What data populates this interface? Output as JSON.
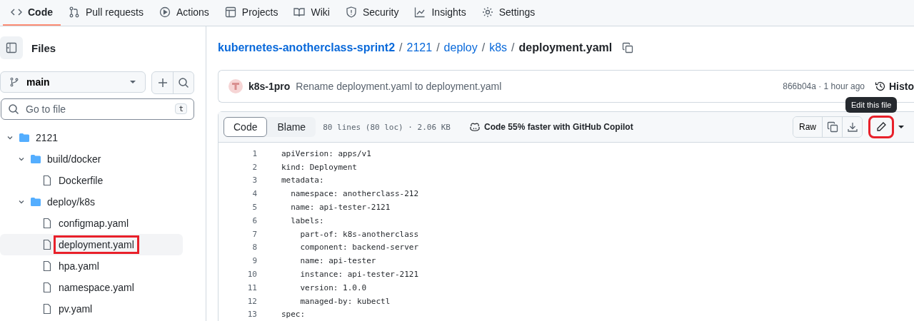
{
  "nav_tabs": [
    {
      "label": "Code",
      "selected": true
    },
    {
      "label": "Pull requests",
      "selected": false
    },
    {
      "label": "Actions",
      "selected": false
    },
    {
      "label": "Projects",
      "selected": false
    },
    {
      "label": "Wiki",
      "selected": false
    },
    {
      "label": "Security",
      "selected": false
    },
    {
      "label": "Insights",
      "selected": false
    },
    {
      "label": "Settings",
      "selected": false
    }
  ],
  "sidebar": {
    "title": "Files",
    "branch": "main",
    "search_placeholder": "Go to file",
    "search_key": "t",
    "tree": [
      {
        "name": "2121",
        "kind": "folder",
        "expanded": true,
        "selected": false,
        "highlighted": false,
        "children": [
          {
            "name": "build/docker",
            "kind": "folder",
            "expanded": true,
            "selected": false,
            "highlighted": false,
            "children": [
              {
                "name": "Dockerfile",
                "kind": "file",
                "selected": false,
                "highlighted": false
              }
            ]
          },
          {
            "name": "deploy/k8s",
            "kind": "folder",
            "expanded": true,
            "selected": false,
            "highlighted": false,
            "children": [
              {
                "name": "configmap.yaml",
                "kind": "file",
                "selected": false,
                "highlighted": false
              },
              {
                "name": "deployment.yaml",
                "kind": "file",
                "selected": true,
                "highlighted": true
              },
              {
                "name": "hpa.yaml",
                "kind": "file",
                "selected": false,
                "highlighted": false
              },
              {
                "name": "namespace.yaml",
                "kind": "file",
                "selected": false,
                "highlighted": false
              },
              {
                "name": "pv.yaml",
                "kind": "file",
                "selected": false,
                "highlighted": false
              }
            ]
          }
        ]
      }
    ]
  },
  "breadcrumb": [
    {
      "text": "kubernetes-anotherclass-sprint2",
      "kind": "link"
    },
    {
      "text": "/",
      "kind": "separator"
    },
    {
      "text": "2121",
      "kind": "link"
    },
    {
      "text": "/",
      "kind": "separator"
    },
    {
      "text": "deploy",
      "kind": "link"
    },
    {
      "text": "/",
      "kind": "separator"
    },
    {
      "text": "k8s",
      "kind": "link"
    },
    {
      "text": "/",
      "kind": "separator"
    },
    {
      "text": "deployment.yaml",
      "kind": "current"
    }
  ],
  "commit": {
    "author": "k8s-1pro",
    "message": "Rename deployment.yaml to deployment.yaml",
    "hash_time": "866b04a · 1 hour ago",
    "history": "Histo"
  },
  "file_header": {
    "views": [
      {
        "label": "Code",
        "selected": true
      },
      {
        "label": "Blame",
        "selected": false
      }
    ],
    "info": "80 lines (80 loc) · 2.06 KB",
    "copilot": "Code 55% faster with GitHub Copilot",
    "raw": "Raw",
    "edit_highlighted": true,
    "tooltip": "Edit this file"
  },
  "code_lines": [
    {
      "number": "1",
      "text": "apiVersion: apps/v1"
    },
    {
      "number": "2",
      "text": "kind: Deployment"
    },
    {
      "number": "3",
      "text": "metadata:"
    },
    {
      "number": "4",
      "text": "  namespace: anotherclass-212"
    },
    {
      "number": "5",
      "text": "  name: api-tester-2121"
    },
    {
      "number": "6",
      "text": "  labels:"
    },
    {
      "number": "7",
      "text": "    part-of: k8s-anotherclass"
    },
    {
      "number": "8",
      "text": "    component: backend-server"
    },
    {
      "number": "9",
      "text": "    name: api-tester"
    },
    {
      "number": "10",
      "text": "    instance: api-tester-2121"
    },
    {
      "number": "11",
      "text": "    version: 1.0.0"
    },
    {
      "number": "12",
      "text": "    managed-by: kubectl"
    },
    {
      "number": "13",
      "text": "spec:"
    }
  ]
}
